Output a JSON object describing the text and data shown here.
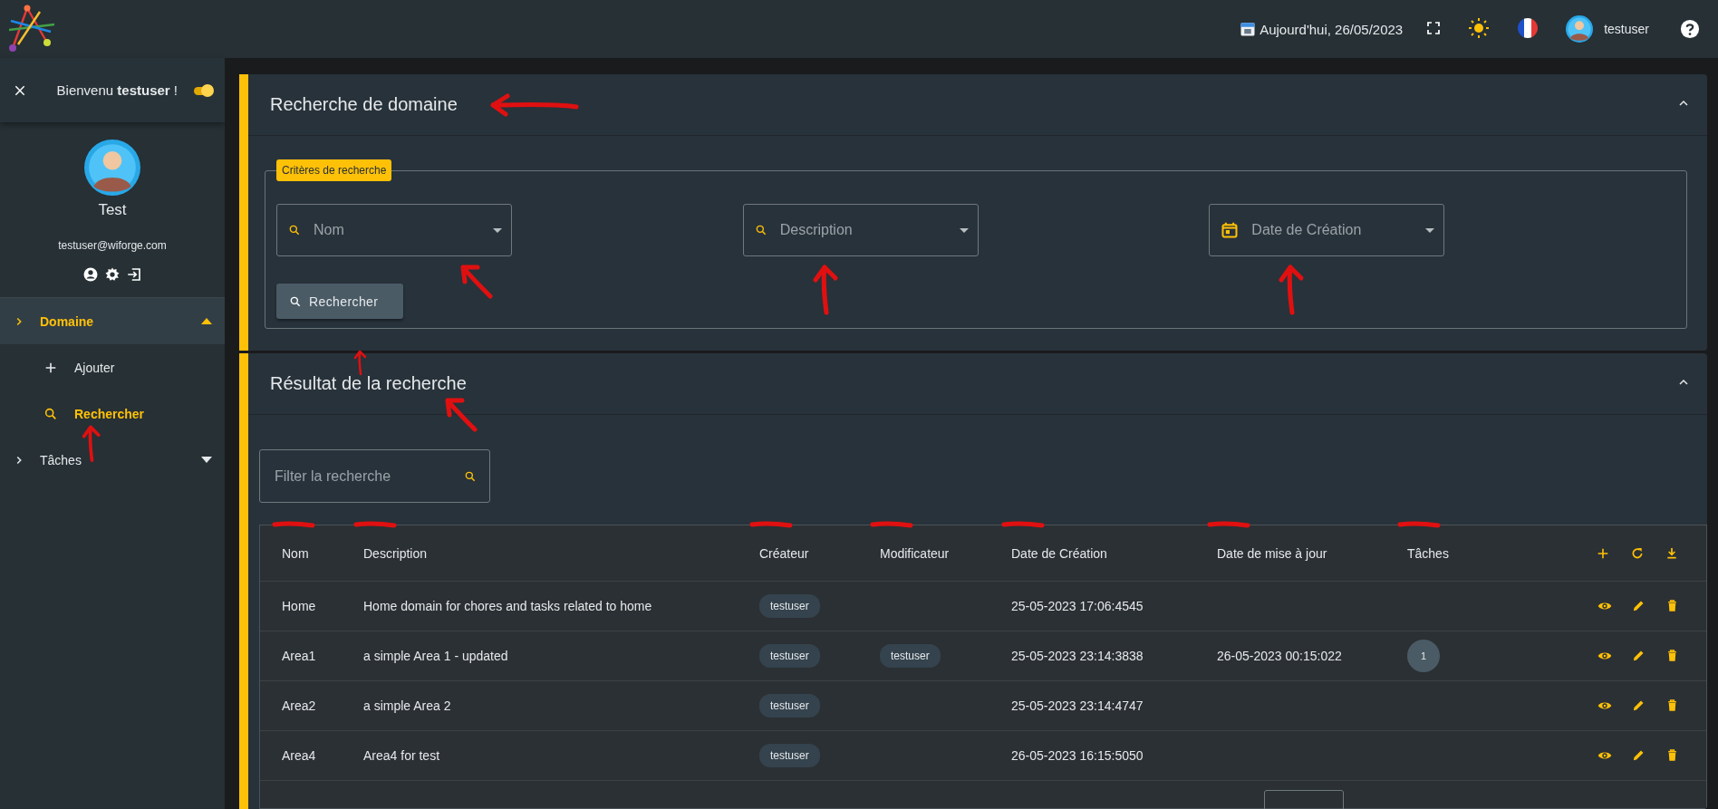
{
  "top_bar": {
    "date": "Aujourd'hui, 26/05/2023",
    "username": "testuser"
  },
  "sidebar": {
    "welcome": "Bienvenu **testuser** !",
    "toggle_on": true,
    "profile": {
      "name": "Test",
      "email": "testuser@wiforge.com"
    },
    "menu": [
      {
        "label": "Domaine",
        "selected": true,
        "expanded": true,
        "children": [
          {
            "label": "Ajouter",
            "kind": "plus",
            "selected": false
          },
          {
            "label": "Rechercher",
            "kind": "search",
            "selected": true,
            "annotated": true
          }
        ]
      },
      {
        "label": "Tâches",
        "selected": false,
        "expanded": false
      }
    ]
  },
  "search_panel": {
    "title": "Recherche de domaine",
    "expanded": true,
    "annotated": true,
    "legend": "Critères de recherche",
    "fields": [
      {
        "placeholder": "Nom",
        "kind": "search",
        "annotated": true
      },
      {
        "placeholder": "Description",
        "kind": "search",
        "annotated": true
      },
      {
        "placeholder": "Date de Création",
        "kind": "date",
        "annotated": true
      }
    ],
    "button": {
      "label": "Rechercher",
      "annotated": true
    }
  },
  "results_panel": {
    "title": "Résultat de la recherche",
    "expanded": true,
    "annotated": true,
    "filter": {
      "placeholder": "Filter la recherche"
    },
    "table": {
      "columns": [
        {
          "label": "Nom",
          "annotated": true
        },
        {
          "label": "Description",
          "annotated": true
        },
        {
          "label": "Créateur",
          "annotated": true
        },
        {
          "label": "Modificateur",
          "annotated": true
        },
        {
          "label": "Date de Création",
          "annotated": true
        },
        {
          "label": "Date de mise à jour",
          "annotated": true
        },
        {
          "label": "Tâches",
          "annotated": true
        }
      ],
      "rows": [
        {
          "nom": "Home",
          "description": "Home domain for chores and tasks related to home",
          "createur": "testuser",
          "date_creation": "25-05-2023 17:06:4545"
        },
        {
          "nom": "Area1",
          "description": "a simple Area 1 - updated",
          "createur": "testuser",
          "modificateur": "testuser",
          "date_creation": "25-05-2023 23:14:3838",
          "date_maj": "26-05-2023 00:15:022",
          "taches": "1"
        },
        {
          "nom": "Area2",
          "description": "a simple Area 2",
          "createur": "testuser",
          "date_creation": "25-05-2023 23:14:4747"
        },
        {
          "nom": "Area4",
          "description": "Area4 for test",
          "createur": "testuser",
          "date_creation": "26-05-2023 16:15:5050"
        }
      ]
    }
  }
}
